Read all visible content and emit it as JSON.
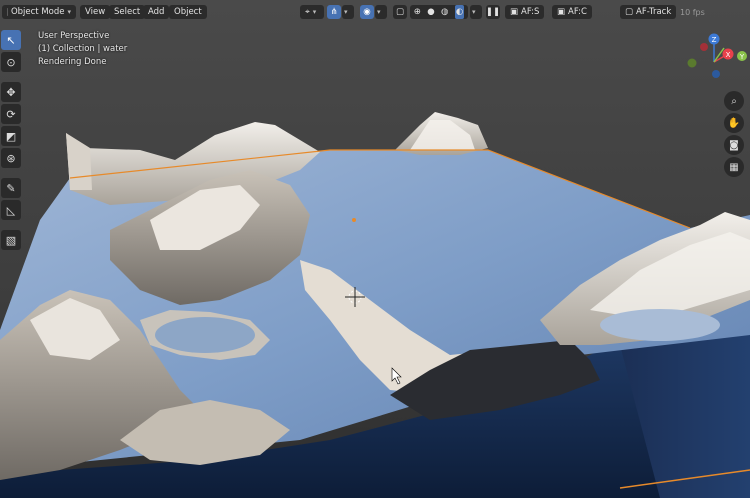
{
  "header": {
    "mode_label": "Object Mode",
    "menus": [
      "View",
      "Select",
      "Add",
      "Object"
    ],
    "addon_buttons": [
      "AF:S",
      "AF:C",
      "AF-Track"
    ],
    "corner_text": "10 fps"
  },
  "overlay": {
    "line1": "User Perspective",
    "line2": "(1) Collection | water",
    "line3": "Rendering Done"
  },
  "gizmo": {
    "x_label": "X",
    "y_label": "Y",
    "z_label": "Z",
    "x_color": "#e8414b",
    "y_color": "#8bc34a",
    "z_color": "#3d7ad6"
  },
  "colors": {
    "active_accent": "#4772b3",
    "water": "#7e9dc7",
    "selection_outline": "#e78a2a"
  },
  "icons": {
    "toolbar": [
      "cursor-select-icon",
      "3d-cursor-icon",
      "move-icon",
      "rotate-icon",
      "scale-icon",
      "transform-icon",
      "annotate-icon",
      "measure-icon",
      "add-cube-icon"
    ],
    "nav": [
      "zoom-icon",
      "pan-hand-icon",
      "camera-icon",
      "grid-icon"
    ]
  }
}
